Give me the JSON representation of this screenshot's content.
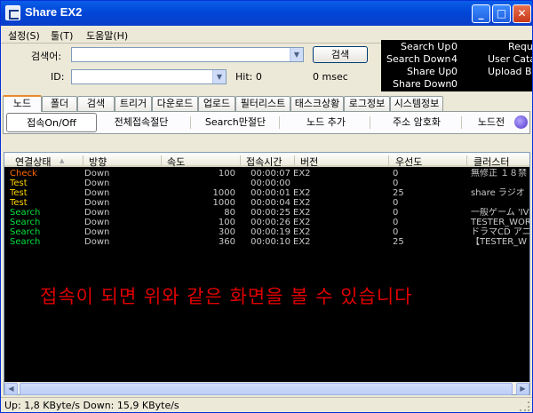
{
  "window": {
    "title": "Share EX2",
    "min": "_",
    "max": "□",
    "close": "✕"
  },
  "menu": [
    {
      "label": "설정(S)"
    },
    {
      "label": "툴(T)"
    },
    {
      "label": "도움말(H)"
    }
  ],
  "search": {
    "keyword_label": "검색어:",
    "keyword_value": "",
    "search_button": "검색",
    "id_label": "ID:",
    "id_value": "",
    "hit_text": "Hit: 0",
    "msec_text": "0 msec"
  },
  "stats": {
    "search_up": "Search Up",
    "search_up_val": "0",
    "search_down": "Search Down",
    "search_down_val": "4",
    "share_up": "Share Up",
    "share_up_val": "0",
    "share_down": "Share Down",
    "share_down_val": "0",
    "right1": "Requ",
    "right2": "User Cata",
    "right3": "Upload Bl"
  },
  "tabs": [
    {
      "label": "노드"
    },
    {
      "label": "폴더"
    },
    {
      "label": "검색"
    },
    {
      "label": "트리거"
    },
    {
      "label": "다운로드"
    },
    {
      "label": "업로드"
    },
    {
      "label": "필터리스트"
    },
    {
      "label": "태스크상황"
    },
    {
      "label": "로그정보"
    },
    {
      "label": "시스템정보"
    }
  ],
  "toolbar": {
    "connect_toggle": "접속On/Off",
    "disconnect_all": "전체접속절단",
    "search_only_disconnect": "Search만절단",
    "add_node": "노드 추가",
    "encrypt_address": "주소 암호화",
    "node_map": "노드전"
  },
  "table": {
    "headers": [
      "연결상태",
      "방향",
      "속도",
      "접속시간",
      "버전",
      "우선도",
      "클러스터"
    ],
    "rows": [
      {
        "status": "Check",
        "direction": "Down",
        "speed": "100",
        "time": "00:00:07",
        "version": "EX2",
        "priority": "0",
        "cluster": "無修正 １８禁"
      },
      {
        "status": "Test",
        "direction": "Down",
        "speed": "",
        "time": "00:00:00",
        "version": "",
        "priority": "0",
        "cluster": ""
      },
      {
        "status": "Test",
        "direction": "Down",
        "speed": "1000",
        "time": "00:00:01",
        "version": "EX2",
        "priority": "25",
        "cluster": "share ラジオ"
      },
      {
        "status": "Test",
        "direction": "Down",
        "speed": "1000",
        "time": "00:00:04",
        "version": "EX2",
        "priority": "0",
        "cluster": ""
      },
      {
        "status": "Search",
        "direction": "Down",
        "speed": "80",
        "time": "00:00:25",
        "version": "EX2",
        "priority": "0",
        "cluster": "一般ゲーム 'IV"
      },
      {
        "status": "Search",
        "direction": "Down",
        "speed": "100",
        "time": "00:00:26",
        "version": "EX2",
        "priority": "0",
        "cluster": "TESTER_WOR"
      },
      {
        "status": "Search",
        "direction": "Down",
        "speed": "300",
        "time": "00:00:19",
        "version": "EX2",
        "priority": "0",
        "cluster": "ドラマCD アニ"
      },
      {
        "status": "Search",
        "direction": "Down",
        "speed": "360",
        "time": "00:00:10",
        "version": "EX2",
        "priority": "25",
        "cluster": "【TESTER_W"
      }
    ],
    "overlay_message": "접속이 되면 위와 같은 화면을 볼 수 있습니다"
  },
  "status_colors": {
    "Check": "#ff6a00",
    "Test": "#ffd200",
    "Search": "#00e03c"
  },
  "statusbar": {
    "text": "Up: 1,8 KByte/s Down: 15,9 KByte/s"
  }
}
